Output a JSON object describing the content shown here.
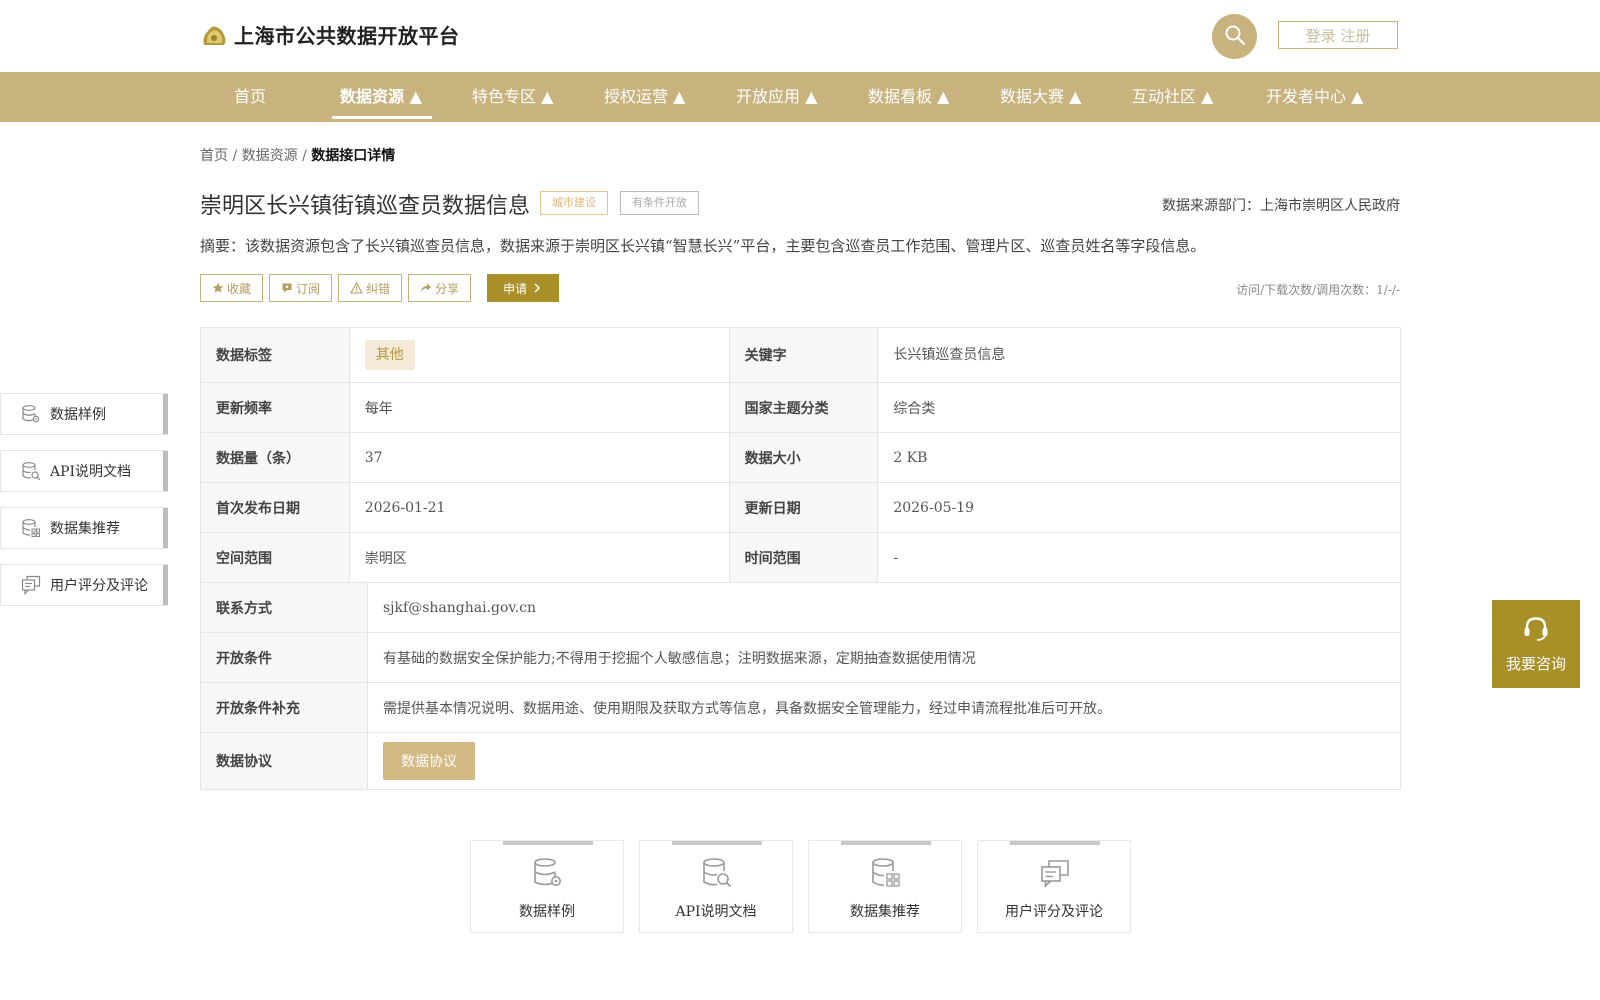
{
  "header": {
    "site_title": "上海市公共数据开放平台",
    "login_label": "登录 注册"
  },
  "nav": {
    "items": [
      "首页",
      "数据资源 ▲",
      "特色专区 ▲",
      "授权运营 ▲",
      "开放应用 ▲",
      "数据看板 ▲",
      "数据大赛 ▲",
      "互动社区 ▲",
      "开发者中心 ▲"
    ],
    "active_index": 1
  },
  "breadcrumb": {
    "home": "首页",
    "sep": "/",
    "section": "数据资源",
    "current": "数据接口详情"
  },
  "dataset": {
    "title": "崇明区长兴镇街镇巡查员数据信息",
    "tags": [
      "城市建设",
      "有条件开放"
    ],
    "source": "数据来源部门：上海市崇明区人民政府",
    "summary": "摘要：该数据资源包含了长兴镇巡查员信息，数据来源于崇明区长兴镇“智慧长兴”平台，主要包含巡查员工作范围、管理片区、巡查员姓名等字段信息。",
    "stats": "访问/下载次数/调用次数：1/-/-"
  },
  "actions": {
    "collect": "收藏",
    "subscribe": "订阅",
    "correct": "纠错",
    "share": "分享",
    "apply": "申请"
  },
  "table": {
    "tag_label": "数据标签",
    "tag_value": "其他",
    "keyword_label": "关键字",
    "keyword_value": "长兴镇巡查员信息",
    "freq_label": "更新频率",
    "freq_value": "每年",
    "theme_label": "国家主题分类",
    "theme_value": "综合类",
    "count_label": "数据量（条）",
    "count_value": "37",
    "size_label": "数据大小",
    "size_value": "2 KB",
    "first_pub_label": "首次发布日期",
    "first_pub_value": "2026-01-21",
    "update_label": "更新日期",
    "update_value": "2026-05-19",
    "space_label": "空间范围",
    "space_value": "崇明区",
    "time_label": "时间范围",
    "time_value": "-",
    "contact_label": "联系方式",
    "contact_value": "sjkf@shanghai.gov.cn",
    "cond_label": "开放条件",
    "cond_value": "有基础的数据安全保护能力;不得用于挖掘个人敏感信息；注明数据来源，定期抽查数据使用情况",
    "cond_extra_label": "开放条件补充",
    "cond_extra_value": "需提供基本情况说明、数据用途、使用期限及获取方式等信息，具备数据安全管理能力，经过申请流程批准后可开放。",
    "agreement_label": "数据协议",
    "agreement_button": "数据协议"
  },
  "sections": [
    "数据样例",
    "API说明文档",
    "数据集推荐",
    "用户评分及评论"
  ],
  "consult_label": "我要咨询",
  "colors": {
    "brand": "#c8b27d",
    "accent": "#a88f28"
  }
}
